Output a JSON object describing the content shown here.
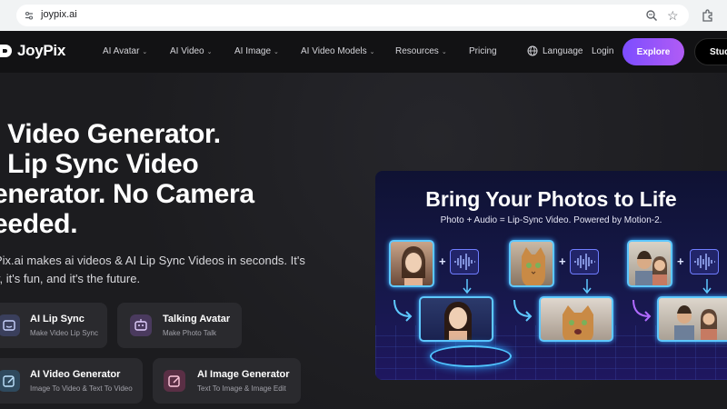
{
  "browser": {
    "url": "joypix.ai"
  },
  "nav": {
    "logo_text": "JoyPix",
    "items": [
      {
        "label": "AI Avatar",
        "dropdown": true
      },
      {
        "label": "AI Video",
        "dropdown": true
      },
      {
        "label": "AI Image",
        "dropdown": true
      },
      {
        "label": "AI Video Models",
        "dropdown": true
      },
      {
        "label": "Resources",
        "dropdown": true
      },
      {
        "label": "Pricing",
        "dropdown": false
      }
    ],
    "language_label": "Language",
    "login_label": "Login",
    "explore_label": "Explore",
    "studio_label": "Stud"
  },
  "hero": {
    "headline_lines": [
      "I Video Generator.",
      "I Lip Sync Video",
      "enerator. No Camera",
      "eeded."
    ],
    "subtext_lines": [
      "Pix.ai makes ai videos & AI Lip Sync Videos in seconds. It's",
      "y, it's fun, and it's the future."
    ],
    "features": [
      {
        "title": "AI Lip Sync",
        "subtitle": "Make Video Lip Sync",
        "icon": "lip-sync-icon",
        "color": "#3a3f5c"
      },
      {
        "title": "Talking Avatar",
        "subtitle": "Make Photo Talk",
        "icon": "robot-icon",
        "color": "#4a3a5e"
      },
      {
        "title": "AI Video Generator",
        "subtitle": "Image To Video & Text To Video",
        "icon": "video-edit-icon",
        "color": "#2f4a5e"
      },
      {
        "title": "AI Image Generator",
        "subtitle": "Text To Image & Image Edit",
        "icon": "image-edit-icon",
        "color": "#5a2f45"
      }
    ]
  },
  "banner": {
    "title": "Bring Your Photos to Life",
    "subtitle": "Photo + Audio = Lip-Sync Video. Powered by Motion-2."
  },
  "colors": {
    "accent": "#8b5cf6",
    "background": "#1c1c1e",
    "nav_background": "#121214"
  }
}
